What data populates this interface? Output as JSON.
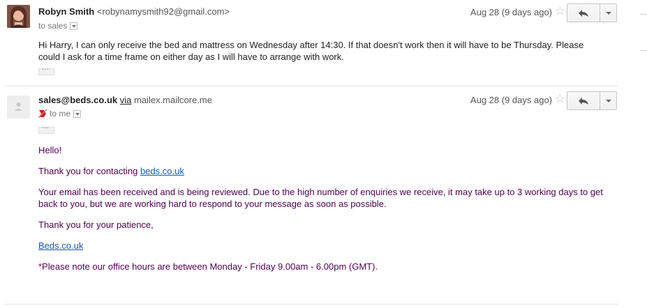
{
  "message1": {
    "sender_name": "Robyn Smith",
    "sender_email": "<robynamysmith92@gmail.com>",
    "recipients": "to sales",
    "date": "Aug 28 (9 days ago)",
    "body": "Hi Harry, I can only receive the bed and mattress on Wednesday after 14:30. If that doesn't work then it will have to be Thursday. Please could I ask for a time frame on either day as I will have to arrange with work.",
    "dots": "···",
    "star": "☆",
    "reply": "↶"
  },
  "message2": {
    "sender_email": "sales@beds.co.uk",
    "via": "via",
    "via_host": "mailex.mailcore.me",
    "recipients": "to me",
    "date": "Aug 28 (9 days ago)",
    "dots": "···",
    "star": "☆",
    "reply": "↶",
    "greeting": "Hello!",
    "thanks_prefix": "Thank you for contacting ",
    "thanks_link": "beds.co.uk",
    "body_p1": "Your email has been received and is being reviewed. Due to the high number of enquiries we receive, it may take up to 3 working days to get back to you, but we are working hard to respond to your message as soon as possible.",
    "patience": "Thank you for your patience,",
    "signature_link": "Beds.co.uk",
    "office_hours": "*Please note our office hours are between Monday - Friday 9.00am - 6.00pm (GMT)."
  },
  "colors": {
    "link": "#1a56a8",
    "quoted_text": "#500050",
    "important_marker": "#c5221f"
  }
}
